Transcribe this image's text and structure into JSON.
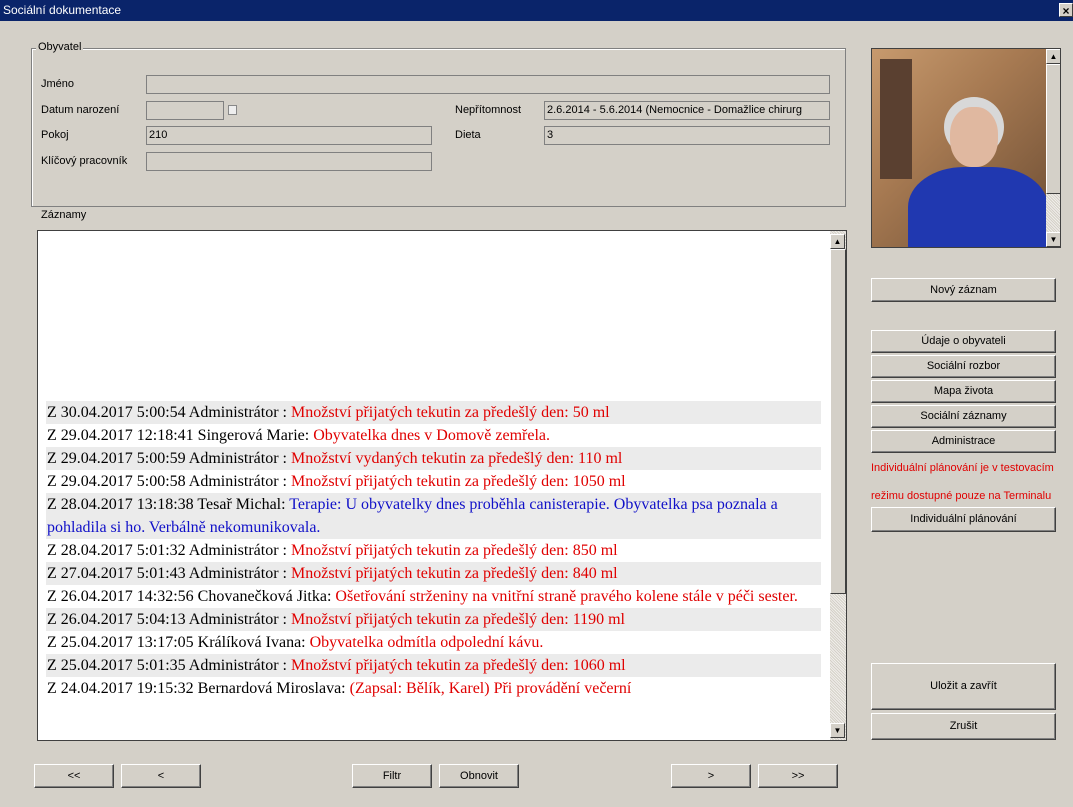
{
  "window": {
    "title": "Sociální dokumentace",
    "close_glyph": "×"
  },
  "resident": {
    "legend": "Obyvatel",
    "name_label": "Jméno",
    "name_value": "",
    "birth_label": "Datum narození",
    "birth_value": "",
    "room_label": "Pokoj",
    "room_value": "210",
    "keyworker_label": "Klíčový pracovník",
    "keyworker_value": "",
    "absence_label": "Nepřítomnost",
    "absence_value": "2.6.2014 - 5.6.2014 (Nemocnice - Domažlice chirurg",
    "diet_label": "Dieta",
    "diet_value": "3"
  },
  "records": {
    "label": "Záznamy",
    "cut_top": "",
    "items": [
      {
        "head": "Z 30.04.2017 5:00:54 Administrátor : ",
        "body": "Množství přijatých tekutin za předešlý den: 50 ml",
        "color": "red",
        "alt": true
      },
      {
        "head": "Z 29.04.2017 12:18:41 Singerová Marie: ",
        "body": "Obyvatelka dnes v Domově zemřela.",
        "color": "red",
        "alt": false
      },
      {
        "head": "Z 29.04.2017 5:00:59 Administrátor : ",
        "body": "Množství vydaných tekutin za předešlý den: 110 ml",
        "color": "red",
        "alt": true
      },
      {
        "head": "Z 29.04.2017 5:00:58 Administrátor : ",
        "body": "Množství přijatých tekutin za předešlý den: 1050 ml",
        "color": "red",
        "alt": false
      },
      {
        "head": "Z 28.04.2017 13:18:38 Tesař Michal: ",
        "body": "Terapie: U obyvatelky dnes proběhla canisterapie. Obyvatelka psa poznala a pohladila si ho. Verbálně nekomunikovala.",
        "color": "blue",
        "alt": true
      },
      {
        "head": "Z 28.04.2017 5:01:32 Administrátor : ",
        "body": "Množství přijatých tekutin za předešlý den: 850 ml",
        "color": "red",
        "alt": false
      },
      {
        "head": "Z 27.04.2017 5:01:43 Administrátor : ",
        "body": "Množství přijatých tekutin za předešlý den: 840 ml",
        "color": "red",
        "alt": true
      },
      {
        "head": "Z 26.04.2017 14:32:56 Chovanečková Jitka: ",
        "body": "Ošetřování strženiny na vnitřní straně pravého kolene stále v péči sester.",
        "color": "red",
        "alt": false
      },
      {
        "head": "Z 26.04.2017 5:04:13 Administrátor : ",
        "body": "Množství přijatých tekutin za předešlý den: 1190 ml",
        "color": "red",
        "alt": true
      },
      {
        "head": "Z 25.04.2017 13:17:05 Králíková Ivana: ",
        "body": "Obyvatelka odmítla odpolední kávu.",
        "color": "red",
        "alt": false
      },
      {
        "head": "Z 25.04.2017 5:01:35 Administrátor : ",
        "body": "Množství přijatých tekutin za předešlý den: 1060 ml",
        "color": "red",
        "alt": true
      },
      {
        "head": "Z 24.04.2017 19:15:32 Bernardová Miroslava: ",
        "body": "(Zapsal: Bělík, Karel) Při provádění večerní",
        "color": "red",
        "alt": false
      }
    ]
  },
  "side_buttons": {
    "new_record": "Nový záznam",
    "resident_info": "Údaje o obyvateli",
    "social_analysis": "Sociální rozbor",
    "life_map": "Mapa života",
    "social_records": "Sociální záznamy",
    "administration": "Administrace",
    "warning_line1": "Individuální plánování je v testovacím",
    "warning_line2": "režimu dostupné pouze na Terminalu",
    "individual_planning": "Individuální plánování",
    "save_close": "Uložit a zavřít",
    "cancel": "Zrušit"
  },
  "bottom_buttons": {
    "first": "<<",
    "prev": "<",
    "filter": "Filtr",
    "refresh": "Obnovit",
    "next": ">",
    "last": ">>"
  },
  "icons": {
    "scroll_up": "up-arrow-icon",
    "scroll_down": "down-arrow-icon",
    "calendar": "calendar-icon"
  },
  "colors": {
    "titlebar": "#0a246a",
    "red_text": "#e00000",
    "blue_text": "#1010c8",
    "window_bg": "#d4d0c8"
  }
}
